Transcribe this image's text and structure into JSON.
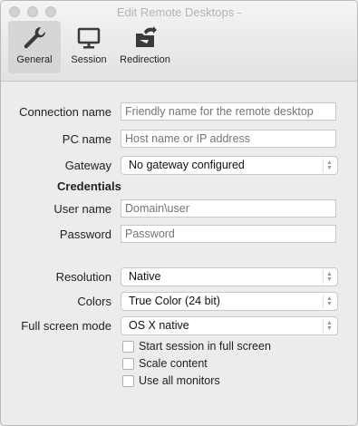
{
  "window": {
    "title": "Edit Remote Desktops -"
  },
  "toolbar": {
    "general_label": "General",
    "session_label": "Session",
    "redirection_label": "Redirection"
  },
  "form": {
    "connection_name": {
      "label": "Connection name",
      "placeholder": "Friendly name for the remote desktop"
    },
    "pc_name": {
      "label": "PC name",
      "placeholder": "Host name or IP address"
    },
    "gateway": {
      "label": "Gateway",
      "value": "No gateway configured"
    },
    "credentials_heading": "Credentials",
    "user_name": {
      "label": "User name",
      "placeholder": "Domain\\user"
    },
    "password": {
      "label": "Password",
      "placeholder": "Password"
    },
    "resolution": {
      "label": "Resolution",
      "value": "Native"
    },
    "colors": {
      "label": "Colors",
      "value": "True Color (24 bit)"
    },
    "full_screen_mode": {
      "label": "Full screen mode",
      "value": "OS X native"
    },
    "checkboxes": [
      {
        "label": "Start session in full screen",
        "checked": false
      },
      {
        "label": "Scale content",
        "checked": false
      },
      {
        "label": "Use all monitors",
        "checked": false
      }
    ]
  },
  "icons": {
    "general": "wrench-icon",
    "session": "monitor-icon",
    "redirection": "folder-redirect-icon"
  }
}
